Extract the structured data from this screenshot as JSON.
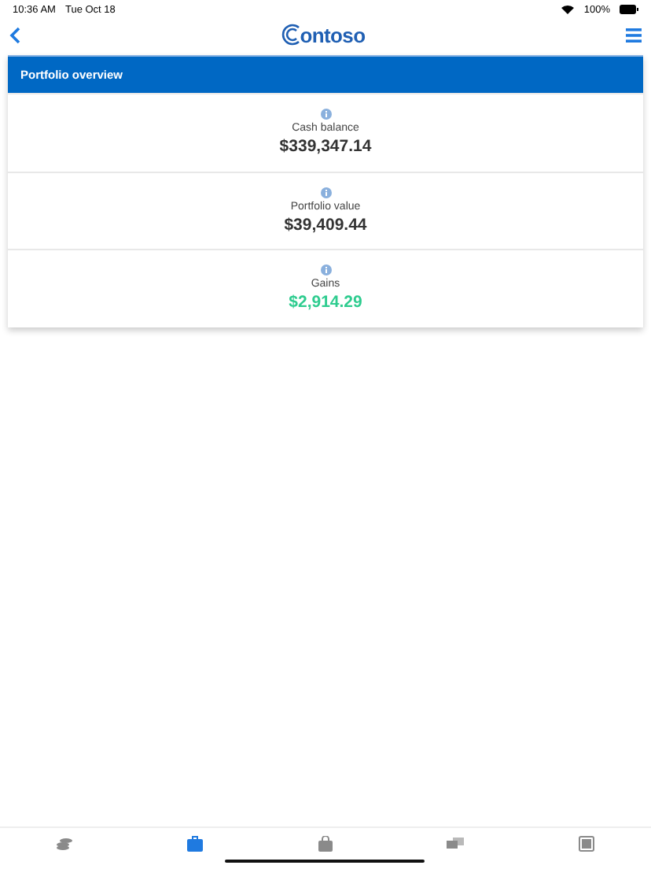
{
  "status_bar": {
    "time": "10:36 AM",
    "date": "Tue Oct 18",
    "battery": "100%"
  },
  "nav": {
    "logo": "ontoso"
  },
  "card": {
    "title": "Portfolio overview",
    "rows": [
      {
        "label": "Cash balance",
        "value": "$339,347.14",
        "kind": "neutral"
      },
      {
        "label": "Portfolio value",
        "value": "$39,409.44",
        "kind": "neutral"
      },
      {
        "label": "Gains",
        "value": "$2,914.29",
        "kind": "gain"
      }
    ]
  },
  "tabs": [
    {
      "kind": "coins",
      "selected": false
    },
    {
      "kind": "briefcase",
      "selected": true
    },
    {
      "kind": "bag",
      "selected": false
    },
    {
      "kind": "exchange",
      "selected": false
    },
    {
      "kind": "calculator",
      "selected": false
    }
  ]
}
